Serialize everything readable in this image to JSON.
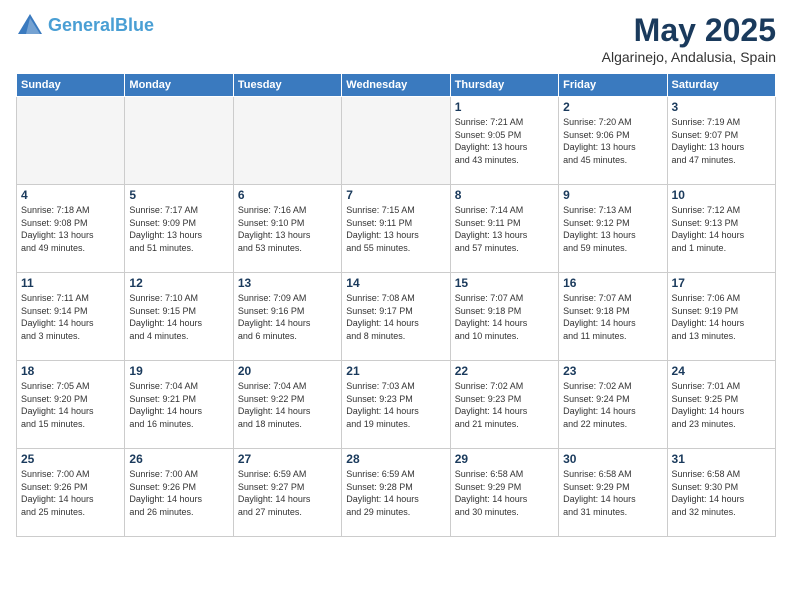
{
  "header": {
    "logo_line1": "General",
    "logo_line2": "Blue",
    "month_title": "May 2025",
    "subtitle": "Algarinejo, Andalusia, Spain"
  },
  "weekdays": [
    "Sunday",
    "Monday",
    "Tuesday",
    "Wednesday",
    "Thursday",
    "Friday",
    "Saturday"
  ],
  "weeks": [
    [
      {
        "day": "",
        "info": ""
      },
      {
        "day": "",
        "info": ""
      },
      {
        "day": "",
        "info": ""
      },
      {
        "day": "",
        "info": ""
      },
      {
        "day": "1",
        "info": "Sunrise: 7:21 AM\nSunset: 9:05 PM\nDaylight: 13 hours\nand 43 minutes."
      },
      {
        "day": "2",
        "info": "Sunrise: 7:20 AM\nSunset: 9:06 PM\nDaylight: 13 hours\nand 45 minutes."
      },
      {
        "day": "3",
        "info": "Sunrise: 7:19 AM\nSunset: 9:07 PM\nDaylight: 13 hours\nand 47 minutes."
      }
    ],
    [
      {
        "day": "4",
        "info": "Sunrise: 7:18 AM\nSunset: 9:08 PM\nDaylight: 13 hours\nand 49 minutes."
      },
      {
        "day": "5",
        "info": "Sunrise: 7:17 AM\nSunset: 9:09 PM\nDaylight: 13 hours\nand 51 minutes."
      },
      {
        "day": "6",
        "info": "Sunrise: 7:16 AM\nSunset: 9:10 PM\nDaylight: 13 hours\nand 53 minutes."
      },
      {
        "day": "7",
        "info": "Sunrise: 7:15 AM\nSunset: 9:11 PM\nDaylight: 13 hours\nand 55 minutes."
      },
      {
        "day": "8",
        "info": "Sunrise: 7:14 AM\nSunset: 9:11 PM\nDaylight: 13 hours\nand 57 minutes."
      },
      {
        "day": "9",
        "info": "Sunrise: 7:13 AM\nSunset: 9:12 PM\nDaylight: 13 hours\nand 59 minutes."
      },
      {
        "day": "10",
        "info": "Sunrise: 7:12 AM\nSunset: 9:13 PM\nDaylight: 14 hours\nand 1 minute."
      }
    ],
    [
      {
        "day": "11",
        "info": "Sunrise: 7:11 AM\nSunset: 9:14 PM\nDaylight: 14 hours\nand 3 minutes."
      },
      {
        "day": "12",
        "info": "Sunrise: 7:10 AM\nSunset: 9:15 PM\nDaylight: 14 hours\nand 4 minutes."
      },
      {
        "day": "13",
        "info": "Sunrise: 7:09 AM\nSunset: 9:16 PM\nDaylight: 14 hours\nand 6 minutes."
      },
      {
        "day": "14",
        "info": "Sunrise: 7:08 AM\nSunset: 9:17 PM\nDaylight: 14 hours\nand 8 minutes."
      },
      {
        "day": "15",
        "info": "Sunrise: 7:07 AM\nSunset: 9:18 PM\nDaylight: 14 hours\nand 10 minutes."
      },
      {
        "day": "16",
        "info": "Sunrise: 7:07 AM\nSunset: 9:18 PM\nDaylight: 14 hours\nand 11 minutes."
      },
      {
        "day": "17",
        "info": "Sunrise: 7:06 AM\nSunset: 9:19 PM\nDaylight: 14 hours\nand 13 minutes."
      }
    ],
    [
      {
        "day": "18",
        "info": "Sunrise: 7:05 AM\nSunset: 9:20 PM\nDaylight: 14 hours\nand 15 minutes."
      },
      {
        "day": "19",
        "info": "Sunrise: 7:04 AM\nSunset: 9:21 PM\nDaylight: 14 hours\nand 16 minutes."
      },
      {
        "day": "20",
        "info": "Sunrise: 7:04 AM\nSunset: 9:22 PM\nDaylight: 14 hours\nand 18 minutes."
      },
      {
        "day": "21",
        "info": "Sunrise: 7:03 AM\nSunset: 9:23 PM\nDaylight: 14 hours\nand 19 minutes."
      },
      {
        "day": "22",
        "info": "Sunrise: 7:02 AM\nSunset: 9:23 PM\nDaylight: 14 hours\nand 21 minutes."
      },
      {
        "day": "23",
        "info": "Sunrise: 7:02 AM\nSunset: 9:24 PM\nDaylight: 14 hours\nand 22 minutes."
      },
      {
        "day": "24",
        "info": "Sunrise: 7:01 AM\nSunset: 9:25 PM\nDaylight: 14 hours\nand 23 minutes."
      }
    ],
    [
      {
        "day": "25",
        "info": "Sunrise: 7:00 AM\nSunset: 9:26 PM\nDaylight: 14 hours\nand 25 minutes."
      },
      {
        "day": "26",
        "info": "Sunrise: 7:00 AM\nSunset: 9:26 PM\nDaylight: 14 hours\nand 26 minutes."
      },
      {
        "day": "27",
        "info": "Sunrise: 6:59 AM\nSunset: 9:27 PM\nDaylight: 14 hours\nand 27 minutes."
      },
      {
        "day": "28",
        "info": "Sunrise: 6:59 AM\nSunset: 9:28 PM\nDaylight: 14 hours\nand 29 minutes."
      },
      {
        "day": "29",
        "info": "Sunrise: 6:58 AM\nSunset: 9:29 PM\nDaylight: 14 hours\nand 30 minutes."
      },
      {
        "day": "30",
        "info": "Sunrise: 6:58 AM\nSunset: 9:29 PM\nDaylight: 14 hours\nand 31 minutes."
      },
      {
        "day": "31",
        "info": "Sunrise: 6:58 AM\nSunset: 9:30 PM\nDaylight: 14 hours\nand 32 minutes."
      }
    ]
  ]
}
